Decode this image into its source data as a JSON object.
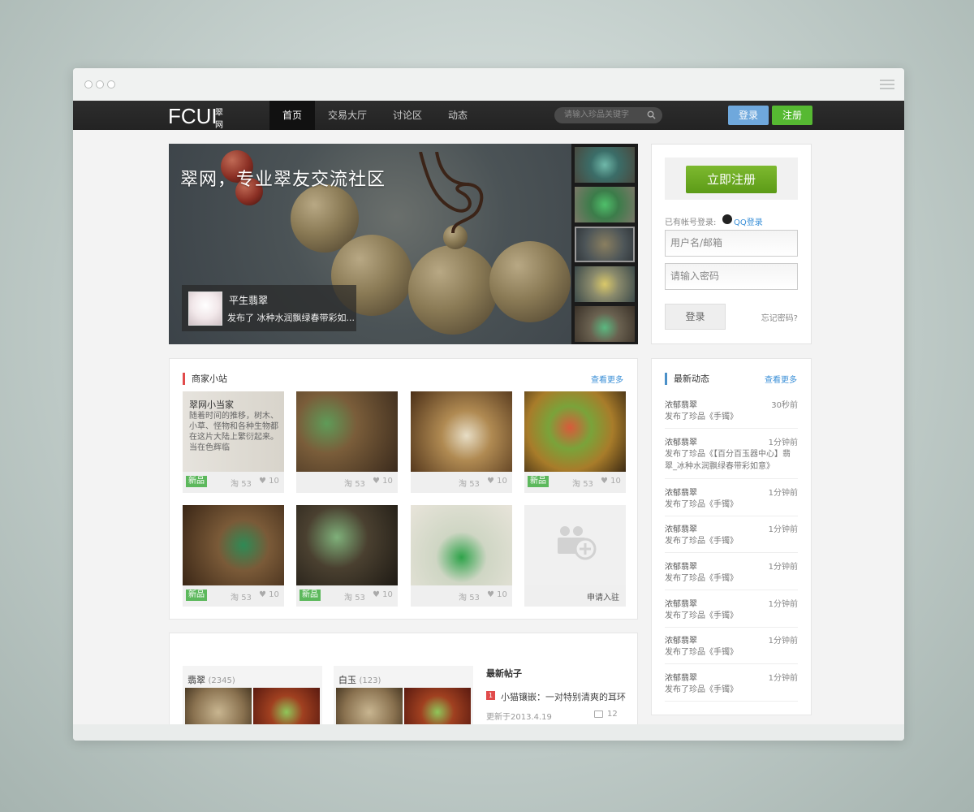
{
  "window": {
    "controls": [
      "dot",
      "dot",
      "dot"
    ],
    "menu_icon": "hamburger-icon"
  },
  "nav": {
    "logo": "FCUI",
    "logo_sub": "翠网",
    "items": [
      {
        "label": "首页",
        "active": true
      },
      {
        "label": "交易大厅",
        "active": false
      },
      {
        "label": "讨论区",
        "active": false
      },
      {
        "label": "动态",
        "active": false
      }
    ],
    "search_placeholder": "请输入珍品关键字",
    "search_icon": "search-icon",
    "login_label": "登录",
    "register_label": "注册",
    "colors": {
      "bar": "#2b2b2b",
      "login": "#6fa8dc",
      "register": "#56b932"
    }
  },
  "hero": {
    "title": "翠网，专业翠友交流社区",
    "card": {
      "name": "平生翡翠",
      "text": "发布了 冰种水润飘绿春带彩如..."
    }
  },
  "register_panel": {
    "cta": "立即注册",
    "hint": "已有帐号登录:",
    "qq_label": "QQ登录",
    "username_placeholder": "用户名/邮箱",
    "password_placeholder": "请输入密码",
    "login_label": "登录",
    "forgot_label": "忘记密码?"
  },
  "shops": {
    "title": "商家小站",
    "more": "查看更多",
    "intro": {
      "title": "翠网小当家",
      "text": "随着时间的推移，树木、小草、怪物和各种生物都在这片大陆上繁衍起来。当在色辉临",
      "new": true,
      "tao": "53",
      "likes": "10"
    },
    "items": [
      {
        "new": false,
        "tao": "53",
        "likes": "10"
      },
      {
        "new": false,
        "tao": "53",
        "likes": "10"
      },
      {
        "new": true,
        "tao": "53",
        "likes": "10"
      },
      {
        "new": true,
        "tao": "53",
        "likes": "10"
      },
      {
        "new": true,
        "tao": "53",
        "likes": "10"
      },
      {
        "new": false,
        "tao": "53",
        "likes": "10"
      }
    ],
    "tao_prefix": "淘",
    "apply_label": "申请入驻"
  },
  "feed": {
    "title": "最新动态",
    "more": "查看更多",
    "items": [
      {
        "user": "浓郁翡翠",
        "time": "30秒前",
        "action": "发布了珍品《手镯》"
      },
      {
        "user": "浓郁翡翠",
        "time": "1分钟前",
        "action": "发布了珍品《【百分百玉器中心】翡翠_冰种水润飘绿春带彩如意》"
      },
      {
        "user": "浓郁翡翠",
        "time": "1分钟前",
        "action": "发布了珍品《手镯》"
      },
      {
        "user": "浓郁翡翠",
        "time": "1分钟前",
        "action": "发布了珍品《手镯》"
      },
      {
        "user": "浓郁翡翠",
        "time": "1分钟前",
        "action": "发布了珍品《手镯》"
      },
      {
        "user": "浓郁翡翠",
        "time": "1分钟前",
        "action": "发布了珍品《手镯》"
      },
      {
        "user": "浓郁翡翠",
        "time": "1分钟前",
        "action": "发布了珍品《手镯》"
      },
      {
        "user": "浓郁翡翠",
        "time": "1分钟前",
        "action": "发布了珍品《手镯》"
      }
    ]
  },
  "forum": {
    "categories": [
      {
        "name": "翡翠",
        "count": "(2345)"
      },
      {
        "name": "白玉",
        "count": "(123)"
      }
    ],
    "posts_title": "最新帖子",
    "post": {
      "rank": "1",
      "title": "小猫镶嵌：一对特别清爽的耳环",
      "updated": "更新于2013.4.19",
      "comments": "12"
    }
  }
}
